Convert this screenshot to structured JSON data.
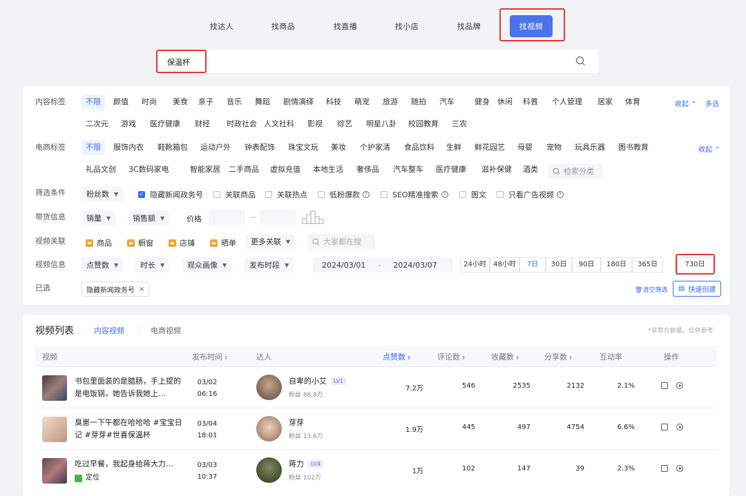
{
  "top_tabs": [
    "找达人",
    "找商品",
    "找直播",
    "找小店",
    "找品牌",
    "找视频"
  ],
  "search": {
    "value": "保温杯"
  },
  "content_tags": {
    "label": "内容标签",
    "row1": [
      "不限",
      "颜值",
      "时尚",
      "美食",
      "亲子",
      "音乐",
      "舞蹈",
      "剧情演绎",
      "科技",
      "萌宠",
      "旅游",
      "随拍",
      "汽车",
      "健身",
      "休闲",
      "科普",
      "个人管理",
      "居家",
      "体育"
    ],
    "row2": [
      "二次元",
      "游戏",
      "医疗健康",
      "财经",
      "时政社会",
      "人文社科",
      "影视",
      "综艺",
      "明星八卦",
      "校园教育",
      "三农"
    ],
    "collapse": "收起",
    "multi": "多选"
  },
  "ecom_tags": {
    "label": "电商标签",
    "row1": [
      "不限",
      "服饰内衣",
      "鞋靴箱包",
      "运动户外",
      "钟表配饰",
      "珠宝文玩",
      "美妆",
      "个护家清",
      "食品饮料",
      "生鲜",
      "鲜花园艺",
      "母婴",
      "宠物",
      "玩具乐器",
      "图书教育"
    ],
    "row2": [
      "礼品文创",
      "3C数码家电",
      "智能家居",
      "二手商品",
      "虚拟充值",
      "本地生活",
      "奢侈品",
      "汽车整车",
      "医疗健康",
      "滋补保健",
      "酒类"
    ],
    "search_placeholder": "检索分类",
    "collapse": "收起"
  },
  "filter_conditions": {
    "label": "筛选条件",
    "dropdown": "粉丝数",
    "checks": [
      "隐藏新闻政务号",
      "关联商品",
      "关联热点",
      "低粉爆款",
      "SEO精准搜索",
      "图文",
      "只看广告视频"
    ]
  },
  "goods_info": {
    "label": "带货信息",
    "sales": "销量",
    "sales_amount": "销售额",
    "price": "价格",
    "dash": "—"
  },
  "video_link": {
    "label": "视频关联",
    "items": [
      "商品",
      "橱窗",
      "店铺",
      "晒单"
    ],
    "more": "更多关联",
    "search_placeholder": "大家都在搜"
  },
  "video_info": {
    "label": "视频信息",
    "dropdowns": [
      "点赞数",
      "时长",
      "观众画像",
      "发布时段"
    ],
    "date_start": "2024/03/01",
    "date_sep": "-",
    "date_end": "2024/03/07",
    "periods": [
      "24小时",
      "48小时",
      "7日",
      "30日",
      "90日",
      "180日",
      "365日",
      "730日"
    ]
  },
  "selected": {
    "label": "已选",
    "tag": "隐藏新闻政务号",
    "close": "×",
    "clear": "清空筛选",
    "quick_create": "快速创建"
  },
  "video_list": {
    "title": "视频列表",
    "tabs": [
      "内容视频",
      "电商视频"
    ],
    "note": "*非官方数据，仅供参考",
    "headers": [
      "视频",
      "发布时间",
      "达人",
      "点赞数",
      "评论数",
      "收藏数",
      "分享数",
      "互动率",
      "操作"
    ],
    "rows": [
      {
        "title": "书包里面装的是腊肠，手上提的是电饭锅，她告诉我她上…",
        "date": "03/02",
        "time": "06:16",
        "author": "自卑的小艾",
        "level": "LV1",
        "fans": "粉丝 86.8万",
        "likes": "7.2万",
        "comments": "546",
        "favorites": "2535",
        "shares": "2132",
        "rate": "2.1%"
      },
      {
        "title": "臭崽一下午都在哈哈哈 #宝宝日记 #芽芽#世喜保温杯",
        "date": "03/04",
        "time": "18:01",
        "author": "芽芽",
        "level": "",
        "fans": "粉丝 13.6万",
        "likes": "1.9万",
        "comments": "445",
        "favorites": "497",
        "shares": "4754",
        "rate": "6.6%"
      },
      {
        "title": "吃过早餐，我起身给蒋大力…",
        "location": "定位",
        "date": "03/03",
        "time": "10:37",
        "author": "蒋力",
        "level": "LV4",
        "fans": "粉丝 102万",
        "likes": "1万",
        "comments": "102",
        "favorites": "147",
        "shares": "39",
        "rate": "2.3%"
      }
    ]
  }
}
